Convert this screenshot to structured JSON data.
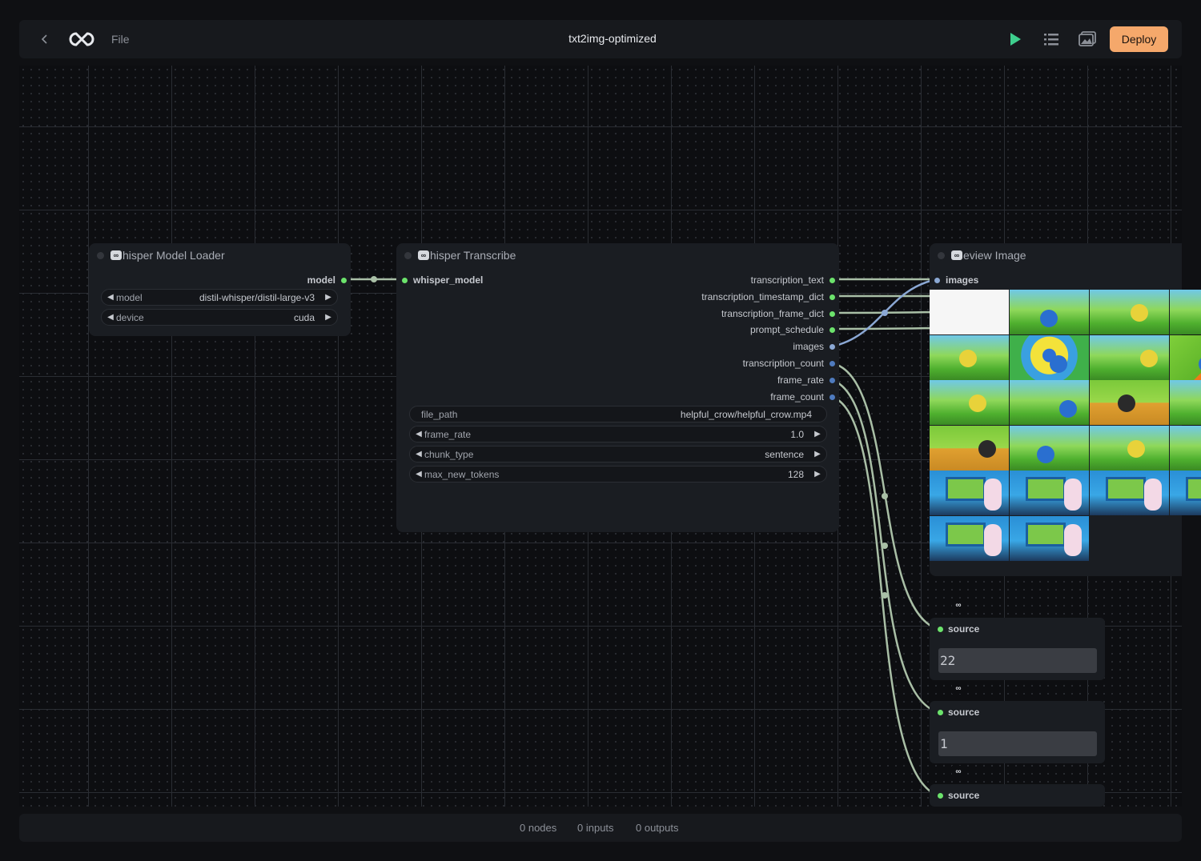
{
  "header": {
    "back_label": "‹",
    "file_label": "File",
    "title": "txt2img-optimized",
    "deploy_label": "Deploy",
    "icons": [
      "back-icon",
      "comfy-logo-icon",
      "play-icon",
      "list-icon",
      "gallery-icon"
    ]
  },
  "colors": {
    "accent": "#f5a86b",
    "run": "#3ecf8e",
    "port_green": "#6ce36c",
    "port_blue": "#4f7bbf",
    "wire": "#a9bfa6"
  },
  "nodes": {
    "loader": {
      "title": "hisper Model Loader",
      "output": "model",
      "widgets": [
        {
          "label": "model",
          "value": "distil-whisper/distil-large-v3"
        },
        {
          "label": "device",
          "value": "cuda"
        }
      ]
    },
    "transcribe": {
      "title": "hisper Transcribe",
      "input": "whisper_model",
      "outputs": [
        "transcription_text",
        "transcription_timestamp_dict",
        "transcription_frame_dict",
        "prompt_schedule",
        "images",
        "transcription_count",
        "frame_rate",
        "frame_count"
      ],
      "widgets": [
        {
          "label": "file_path",
          "value": "helpful_crow/helpful_crow.mp4"
        },
        {
          "label": "frame_rate",
          "value": "1.0"
        },
        {
          "label": "chunk_type",
          "value": "sentence"
        },
        {
          "label": "max_new_tokens",
          "value": "128"
        }
      ]
    },
    "preview": {
      "title": "eview Image",
      "input": "images"
    },
    "sources": [
      {
        "label": "source",
        "value": "22"
      },
      {
        "label": "source",
        "value": "1"
      },
      {
        "label": "source",
        "value": ""
      }
    ]
  },
  "status": {
    "nodes": "0 nodes",
    "inputs": "0 inputs",
    "outputs": "0 outputs"
  }
}
